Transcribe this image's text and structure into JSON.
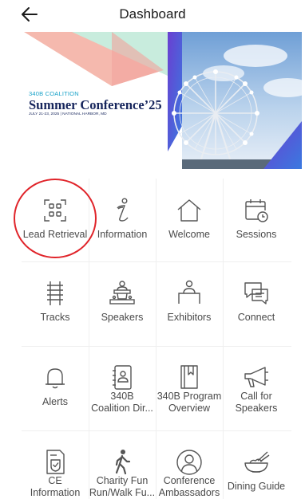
{
  "header": {
    "title": "Dashboard"
  },
  "banner": {
    "org": "340B COALITION",
    "title": "Summer Conference’25",
    "dates": "JULY 21-23, 2025 | NATIONAL HARBOR, MD"
  },
  "tiles": [
    {
      "label": "Lead Retrieval",
      "icon": "qr-scan-icon"
    },
    {
      "label": "Information",
      "icon": "info-icon"
    },
    {
      "label": "Welcome",
      "icon": "home-icon"
    },
    {
      "label": "Sessions",
      "icon": "calendar-clock-icon"
    },
    {
      "label": "Tracks",
      "icon": "tracks-icon"
    },
    {
      "label": "Speakers",
      "icon": "podium-icon"
    },
    {
      "label": "Exhibitors",
      "icon": "booth-icon"
    },
    {
      "label": "Connect",
      "icon": "chat-bubbles-icon"
    },
    {
      "label": "Alerts",
      "icon": "bell-icon"
    },
    {
      "label_lines": [
        "340B",
        "Coalition Dir..."
      ],
      "icon": "address-book-icon"
    },
    {
      "label_lines": [
        "340B Program",
        "Overview"
      ],
      "icon": "book-icon"
    },
    {
      "label_lines": [
        "Call for",
        "Speakers"
      ],
      "icon": "megaphone-icon"
    },
    {
      "label_lines": [
        "CE",
        "Information"
      ],
      "icon": "certificate-icon"
    },
    {
      "label_lines": [
        "Charity Fun",
        "Run/Walk Fu..."
      ],
      "icon": "walking-person-icon"
    },
    {
      "label_lines": [
        "Conference",
        "Ambassadors"
      ],
      "icon": "user-circle-icon"
    },
    {
      "label": "Dining Guide",
      "icon": "bowl-icon"
    }
  ],
  "colors": {
    "highlight_circle": "#e0242a",
    "banner_title": "#16255c",
    "banner_sub": "#1aa3c9"
  }
}
